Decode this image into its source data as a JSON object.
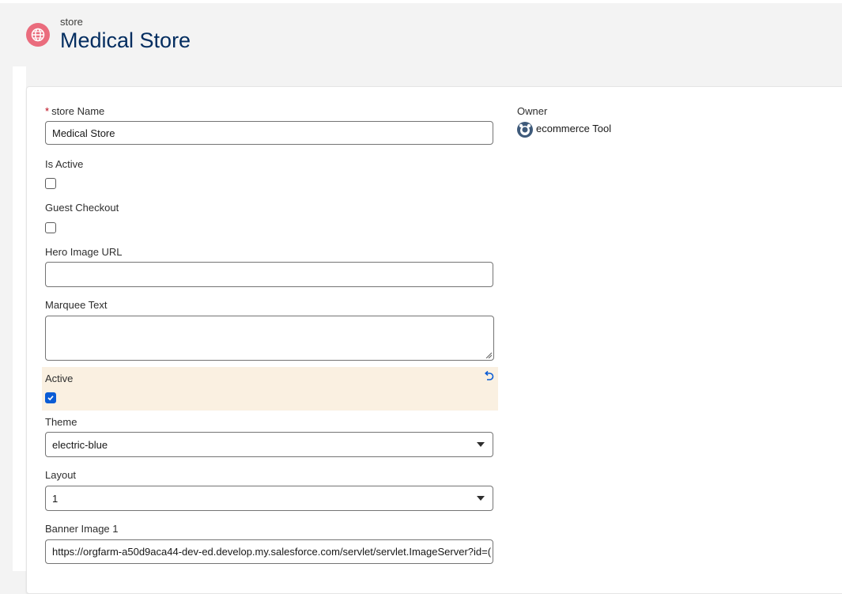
{
  "header": {
    "object_name": "store",
    "title": "Medical Store",
    "icon": "globe-icon",
    "icon_color": "#ea6c7d"
  },
  "form": {
    "store_name": {
      "label": "store Name",
      "required_mark": "*",
      "value": "Medical Store"
    },
    "is_active": {
      "label": "Is Active",
      "checked": false
    },
    "guest_checkout": {
      "label": "Guest Checkout",
      "checked": false
    },
    "hero_image_url": {
      "label": "Hero Image URL",
      "value": ""
    },
    "marquee_text": {
      "label": "Marquee Text",
      "value": ""
    },
    "active": {
      "label": "Active",
      "checked": true,
      "changed": true,
      "undo_icon": "undo-icon"
    },
    "theme": {
      "label": "Theme",
      "value": "electric-blue"
    },
    "layout": {
      "label": "Layout",
      "value": "1"
    },
    "banner_image_1": {
      "label": "Banner Image 1",
      "value": "https://orgfarm-a50d9aca44-dev-ed.develop.my.salesforce.com/servlet/servlet.ImageServer?id=("
    }
  },
  "owner": {
    "label": "Owner",
    "name": "ecommerce Tool",
    "avatar_icon": "user-avatar-icon"
  },
  "colors": {
    "accent": "#0b5cd5",
    "title": "#032d60",
    "changed_field_bg": "#faf0e1",
    "required": "#ba0517"
  }
}
